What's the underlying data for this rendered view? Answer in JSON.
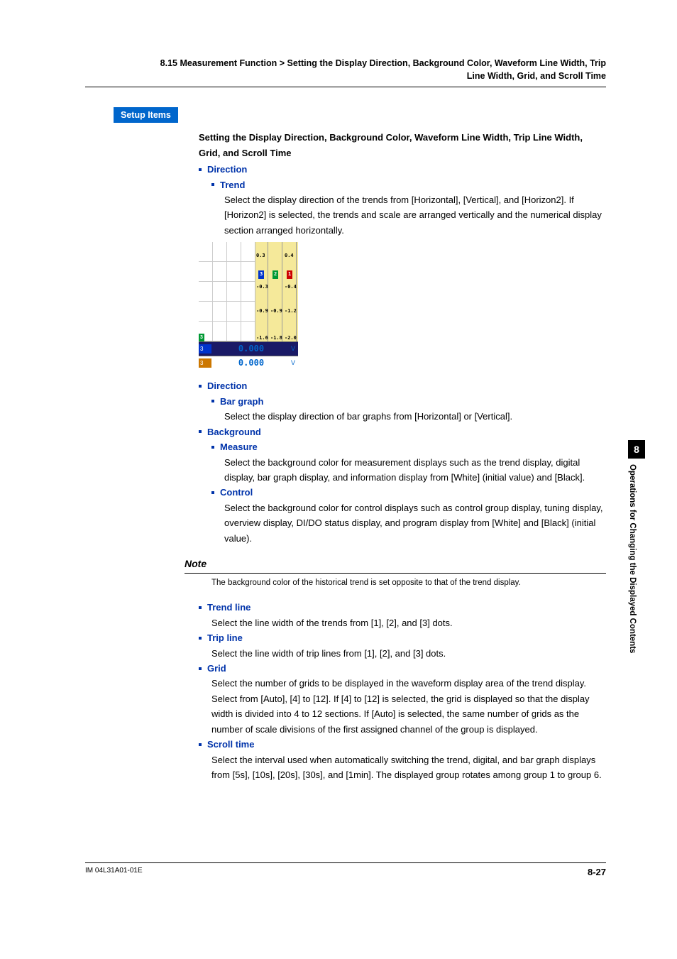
{
  "header": {
    "line1": "8.15  Measurement Function > Setting the Display Direction, Background Color, Waveform Line Width, Trip",
    "line2": "Line Width, Grid, and Scroll Time"
  },
  "setup_badge": "Setup Items",
  "section_title": "Setting the Display Direction, Background Color, Waveform Line Width, Trip Line Width, Grid, and Scroll Time",
  "items": {
    "direction1": "Direction",
    "trend": "Trend",
    "trend_body": "Select the display direction of the trends from [Horizontal], [Vertical], and [Horizon2].  If [Horizon2] is selected, the trends and scale are arranged vertically and the numerical display section arranged horizontally.",
    "direction2": "Direction",
    "bargraph": "Bar graph",
    "bargraph_body": "Select the display direction of bar graphs from [Horizontal] or [Vertical].",
    "background": "Background",
    "measure": "Measure",
    "measure_body": "Select the background color for measurement displays such as the trend display, digital display, bar graph display, and information display from [White] (initial value) and [Black].",
    "control": "Control",
    "control_body": "Select the background color for control displays such as control group display, tuning display, overview display, DI/DO status display, and program display from [White] and [Black] (initial value).",
    "trend_line": "Trend line",
    "trend_line_body": "Select the line width of the trends from [1], [2], and [3] dots.",
    "trip_line": "Trip line",
    "trip_line_body": "Select the line width of trip lines from [1], [2], and [3] dots.",
    "grid": "Grid",
    "grid_body": "Select the number of grids to be displayed in the waveform display area of the trend display.  Select from [Auto], [4] to [12].  If [4] to [12] is selected, the grid is displayed so that the display width is divided into 4 to 12 sections.  If [Auto] is selected, the same number of grids as the number of scale divisions of the first assigned channel of the group is displayed.",
    "scroll": "Scroll time",
    "scroll_body": "Select the interval used when automatically switching the trend, digital, and bar graph displays from [5s], [10s], [20s], [30s], and [1min].  The displayed group rotates among group 1 to group 6."
  },
  "note": {
    "label": "Note",
    "text": "The background color of the historical trend is set opposite to that of the trend display."
  },
  "figure": {
    "scale_cols": [
      {
        "tag": "3",
        "tag_bg": "#0033cc",
        "ticks": [
          "0.3",
          "-0.3",
          "-0.9",
          "-1.6"
        ]
      },
      {
        "tag": "2",
        "tag_bg": "#009933",
        "ticks": [
          "",
          "",
          "-0.9",
          "-1.8"
        ]
      },
      {
        "tag": "1",
        "tag_bg": "#cc0000",
        "ticks": [
          "0.4",
          "-0.4",
          "-1.2",
          "-2.0"
        ]
      }
    ],
    "bottom_rows": [
      {
        "label": "3",
        "label_bg": "#0033cc",
        "row_bg": "#1a1a66",
        "value": "0.000",
        "unit": "V"
      },
      {
        "label": "3",
        "label_bg": "#cc7700",
        "row_bg": "#ffffff",
        "value": "0.000",
        "unit": "V"
      }
    ]
  },
  "side_tab": {
    "chapter": "8",
    "title": "Operations for Changing the Displayed Contents"
  },
  "footer": {
    "doc_id": "IM 04L31A01-01E",
    "page": "8-27"
  }
}
